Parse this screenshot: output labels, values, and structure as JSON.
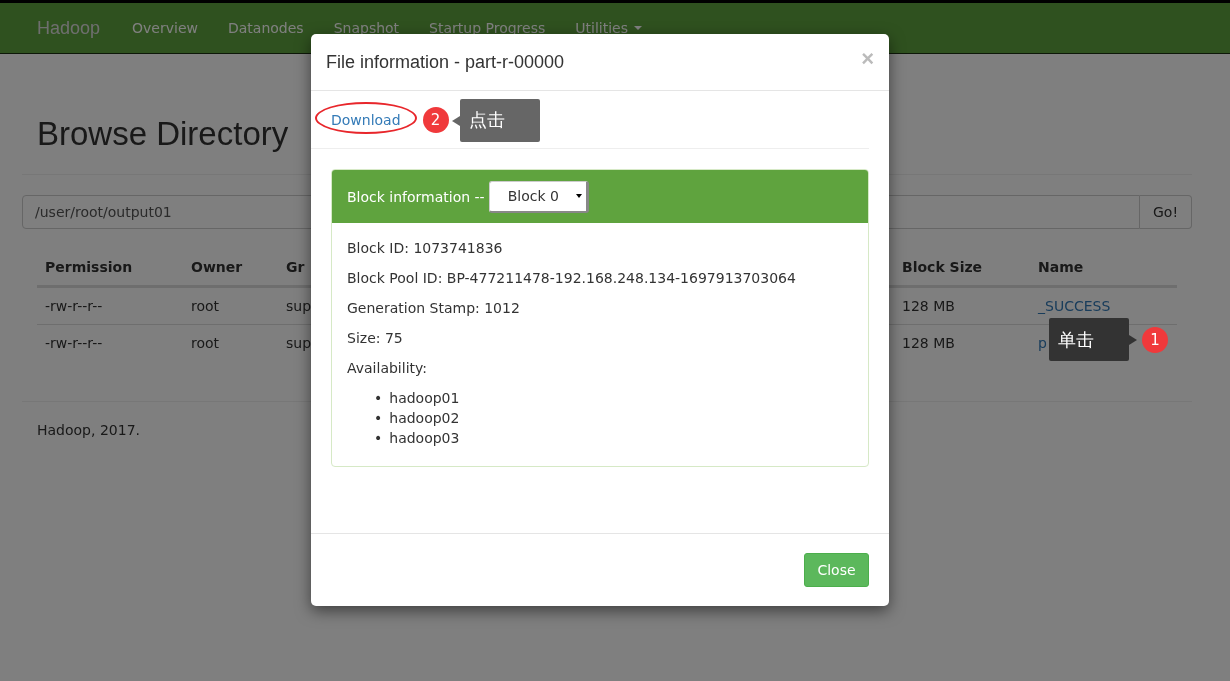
{
  "navbar": {
    "brand": "Hadoop",
    "items": [
      {
        "label": "Overview",
        "dropdown": false
      },
      {
        "label": "Datanodes",
        "dropdown": false
      },
      {
        "label": "Snapshot",
        "dropdown": false
      },
      {
        "label": "Startup Progress",
        "dropdown": false
      },
      {
        "label": "Utilities",
        "dropdown": true
      }
    ]
  },
  "page": {
    "title": "Browse Directory",
    "path_field": {
      "value": "/user/root/output01"
    },
    "go_button": "Go!",
    "table": {
      "columns": [
        "Permission",
        "Owner",
        "Gr",
        "Block Size",
        "Name"
      ],
      "rows": [
        {
          "cells": [
            "-rw-r--r--",
            "root",
            "sup",
            "128 MB",
            "_SUCCESS"
          ]
        },
        {
          "cells": [
            "-rw-r--r--",
            "root",
            "sup",
            "128 MB",
            "p"
          ]
        }
      ]
    },
    "footer": "Hadoop, 2017."
  },
  "modal": {
    "title": "File information - part-r-00000",
    "close_icon": "×",
    "download_link": "Download",
    "panel": {
      "heading": "Block information --",
      "block_select": "Block 0",
      "fields": [
        "Block ID: 1073741836",
        "Block Pool ID: BP-477211478-192.168.248.134-1697913703064",
        "Generation Stamp: 1012",
        "Size: 75",
        "Availability:"
      ],
      "marker": "•",
      "hosts": [
        "hadoop01",
        "hadoop02",
        "hadoop03"
      ]
    },
    "close_button": "Close"
  },
  "annotations": [
    {
      "number": "2",
      "callout": "点击"
    },
    {
      "number": "1",
      "callout": "单击"
    }
  ]
}
